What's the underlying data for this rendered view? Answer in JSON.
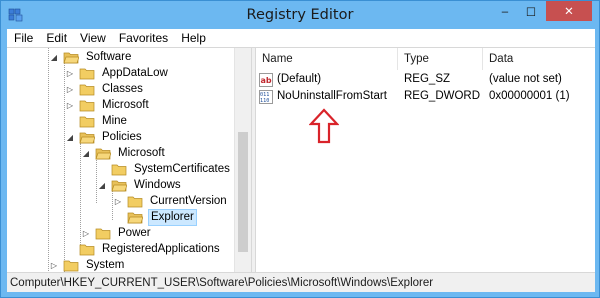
{
  "window": {
    "title": "Registry Editor",
    "minimize": "‒",
    "maximize": "☐",
    "close": "✕",
    "accent_color": "#6cb8f1"
  },
  "menu": [
    "File",
    "Edit",
    "View",
    "Favorites",
    "Help"
  ],
  "tree": {
    "nodes": [
      {
        "label": "Software",
        "expander": "◢",
        "depth": 0
      },
      {
        "label": "AppDataLow",
        "expander": "▷",
        "depth": 1
      },
      {
        "label": "Classes",
        "expander": "▷",
        "depth": 1
      },
      {
        "label": "Microsoft",
        "expander": "▷",
        "depth": 1
      },
      {
        "label": "Mine",
        "expander": "",
        "depth": 1
      },
      {
        "label": "Policies",
        "expander": "◢",
        "depth": 1
      },
      {
        "label": "Microsoft",
        "expander": "◢",
        "depth": 2
      },
      {
        "label": "SystemCertificates",
        "expander": "",
        "depth": 3
      },
      {
        "label": "Windows",
        "expander": "◢",
        "depth": 3
      },
      {
        "label": "CurrentVersion",
        "expander": "▷",
        "depth": 4
      },
      {
        "label": "Explorer",
        "expander": "",
        "depth": 4,
        "selected": true
      },
      {
        "label": "Power",
        "expander": "▷",
        "depth": 2
      },
      {
        "label": "RegisteredApplications",
        "expander": "",
        "depth": 1
      },
      {
        "label": "System",
        "expander": "▷",
        "depth": 0
      }
    ]
  },
  "values": {
    "columns": {
      "name": "Name",
      "type": "Type",
      "data": "Data"
    },
    "rows": [
      {
        "icon": "string-value-icon",
        "name": "(Default)",
        "type": "REG_SZ",
        "data": "(value not set)"
      },
      {
        "icon": "dword-value-icon",
        "name": "NoUninstallFromStart",
        "type": "REG_DWORD",
        "data": "0x00000001 (1)"
      }
    ],
    "arrow_color": "#d9232a"
  },
  "statusbar": {
    "path": "Computer\\HKEY_CURRENT_USER\\Software\\Policies\\Microsoft\\Windows\\Explorer"
  }
}
